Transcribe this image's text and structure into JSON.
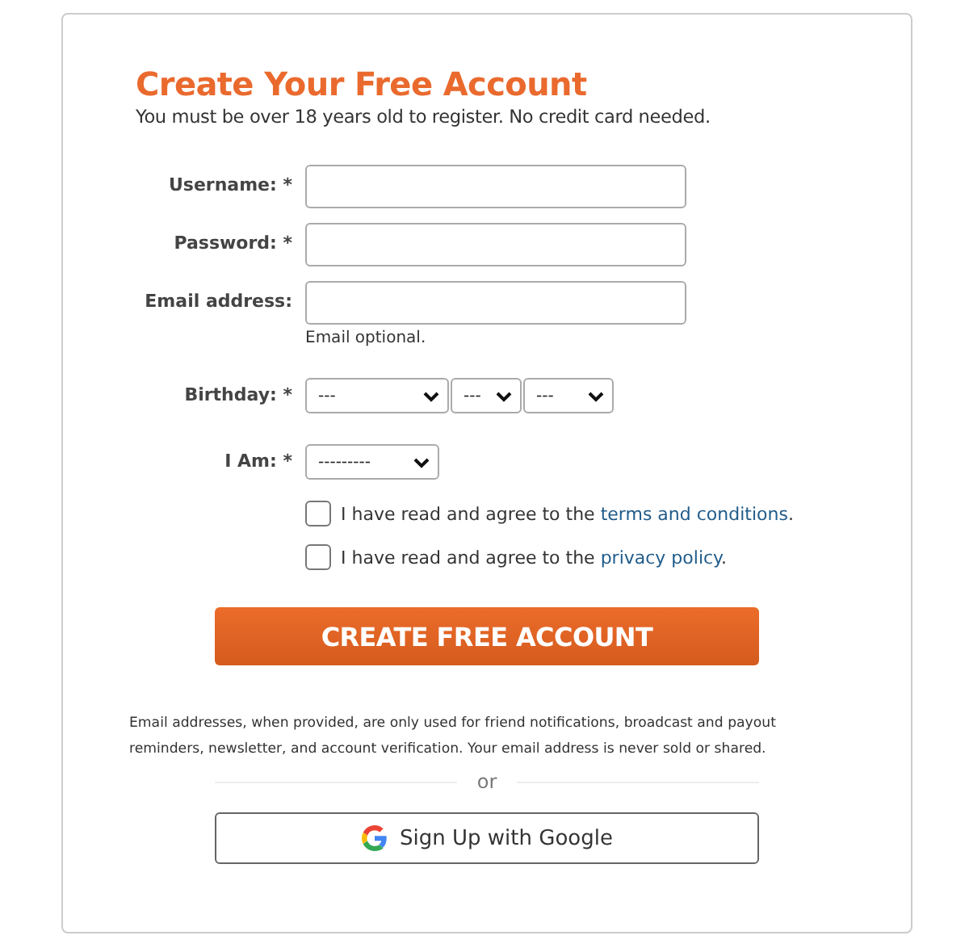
{
  "title": "Create Your Free Account",
  "subtitle": "You must be over 18 years old to register. No credit card needed.",
  "fields": [
    {
      "kind": "text",
      "label": "Username: *"
    },
    {
      "kind": "text",
      "label": "Password: *"
    },
    {
      "kind": "text",
      "label": "Email address:",
      "hint": "Email optional."
    },
    {
      "kind": "selects",
      "label": "Birthday: *",
      "options": [
        "---",
        "---",
        "---"
      ]
    },
    {
      "kind": "selects",
      "label": "I Am: *",
      "options": [
        "---------"
      ]
    }
  ],
  "agreements": [
    {
      "text": "I have read and agree to the ",
      "link": "terms and conditions",
      "after": ".",
      "checked": false
    },
    {
      "text": "I have read and agree to the ",
      "link": "privacy policy",
      "after": ".",
      "checked": false
    }
  ],
  "submit": "CREATE FREE ACCOUNT",
  "note": "Email addresses, when provided, are only used for friend notifications, broadcast and payout reminders, newsletter, and account verification. Your email address is never sold or shared.",
  "divider": "or",
  "google_button": "Sign Up with Google"
}
